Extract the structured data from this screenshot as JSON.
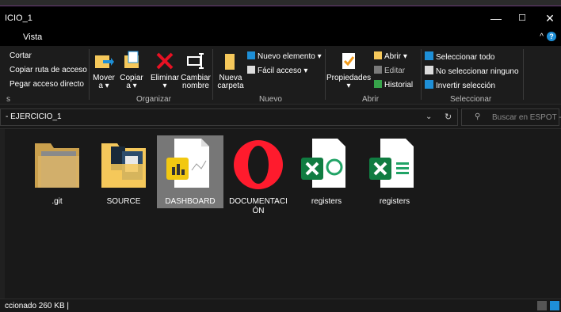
{
  "window": {
    "title": "ICIO_1",
    "controls": {
      "minimize": "—",
      "maximize": "☐",
      "close": "✕"
    }
  },
  "menu": {
    "vista": "Vista",
    "help_caret": "^",
    "help": "?"
  },
  "ribbon": {
    "portapapeles": {
      "cortar": "Cortar",
      "copiar_ruta": "Copiar ruta de acceso",
      "pegar_acceso": "Pegar acceso directo",
      "group_label": "s"
    },
    "organizar": {
      "mover": "Mover",
      "mover_sub": "a ▾",
      "copiar": "Copiar",
      "copiar_sub": "a ▾",
      "eliminar": "Eliminar",
      "eliminar_sub": "▾",
      "cambiar": "Cambiar",
      "cambiar_sub": "nombre",
      "group_label": "Organizar"
    },
    "nuevo": {
      "nueva": "Nueva",
      "nueva_sub": "carpeta",
      "nuevo_elemento": "Nuevo elemento ▾",
      "facil_acceso": "Fácil acceso ▾",
      "group_label": "Nuevo"
    },
    "abrir": {
      "propiedades": "Propiedades",
      "propiedades_sub": "▾",
      "abrir": "Abrir ▾",
      "editar": "Editar",
      "historial": "Historial",
      "group_label": "Abrir"
    },
    "seleccionar": {
      "todo": "Seleccionar todo",
      "ninguno": "No seleccionar ninguno",
      "invertir": "Invertir selección",
      "group_label": "Seleccionar"
    }
  },
  "address": {
    "path": "EJERCICIO_1",
    "dropdown": "⌄",
    "refresh": "↻"
  },
  "search": {
    "placeholder": "Buscar en ESPOT -..."
  },
  "files": [
    {
      "name": ".git",
      "type": "folder"
    },
    {
      "name": "SOURCE",
      "type": "folder-images"
    },
    {
      "name": "DASHBOARD",
      "type": "powerbi",
      "selected": true
    },
    {
      "name": "DOCUMENTACIÓN",
      "type": "opera"
    },
    {
      "name": "registers",
      "type": "excel-green"
    },
    {
      "name": "registers",
      "type": "excel-table"
    }
  ],
  "status": {
    "text": "ccionado  260 KB  |"
  },
  "colors": {
    "accent": "#1e8fd7",
    "selected": "#777777",
    "excel": "#107c41",
    "powerbi": "#f2c811",
    "opera": "#ff1b2d"
  }
}
